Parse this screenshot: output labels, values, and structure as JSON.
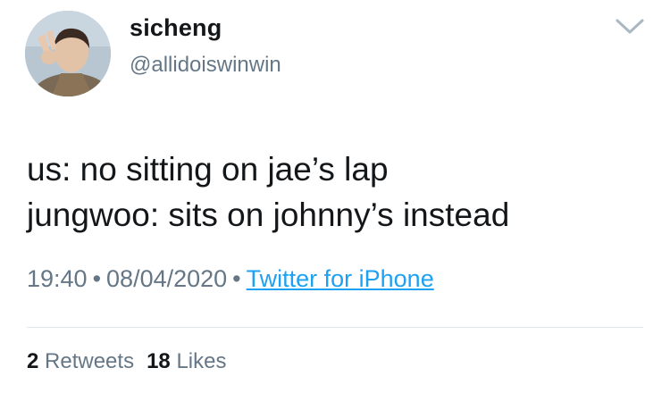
{
  "user": {
    "display_name": "sicheng",
    "handle": "@allidoiswinwin",
    "avatar_icon": "profile-photo"
  },
  "menu": {
    "icon": "chevron-down-icon"
  },
  "tweet": {
    "lines": [
      "us: no sitting on jae’s lap",
      "jungwoo: sits on johnny’s instead"
    ]
  },
  "meta": {
    "time": "19:40",
    "separator": "•",
    "date": "08/04/2020",
    "source": "Twitter for iPhone"
  },
  "stats": {
    "retweets_count": "2",
    "retweets_label": "Retweets",
    "likes_count": "18",
    "likes_label": "Likes"
  },
  "colors": {
    "text_primary": "#14171a",
    "text_secondary": "#657786",
    "link": "#1da1f2",
    "divider": "#e1e8ed"
  }
}
